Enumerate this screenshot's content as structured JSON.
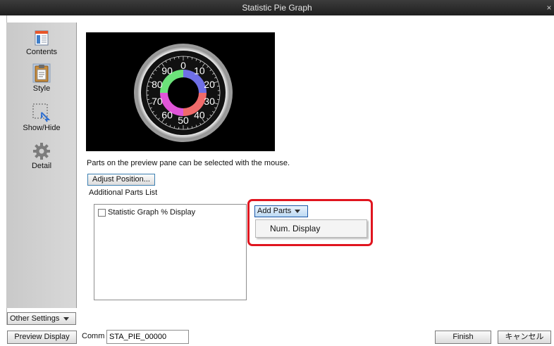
{
  "window": {
    "title": "Statistic Pie Graph",
    "close_glyph": "×"
  },
  "sidebar": {
    "items": [
      {
        "label": "Contents",
        "icon": "contents-icon"
      },
      {
        "label": "Style",
        "icon": "clipboard-icon"
      },
      {
        "label": "Show/Hide",
        "icon": "cursor-select-icon"
      },
      {
        "label": "Detail",
        "icon": "gear-icon"
      }
    ],
    "other_settings_label": "Other Settings"
  },
  "preview": {
    "gauge_scale_labels": [
      "0",
      "10",
      "20",
      "30",
      "40",
      "50",
      "60",
      "70",
      "80",
      "90"
    ],
    "slice_colors": [
      "#6f6fe6",
      "#f06a6a",
      "#e055d8",
      "#6ce27a"
    ]
  },
  "main": {
    "hint": "Parts on the preview pane can be selected with the mouse.",
    "adjust_position_label": "Adjust Position...",
    "additional_parts_label": "Additional Parts List",
    "parts": [
      {
        "label": "Statistic Graph % Display",
        "checked": false
      }
    ],
    "add_parts_label": "Add Parts",
    "add_parts_menu": [
      "Num. Display"
    ],
    "highlight_color": "#e0151f"
  },
  "footer": {
    "preview_display_label": "Preview Display",
    "comm_label": "Comm",
    "comm_value": "STA_PIE_00000",
    "finish_label": "Finish",
    "cancel_label": "キャンセル"
  }
}
